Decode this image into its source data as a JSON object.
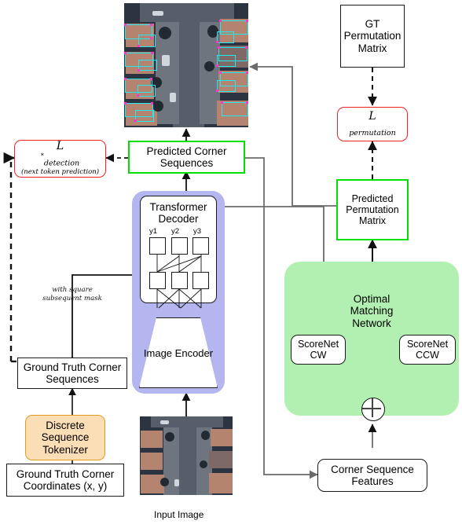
{
  "diagram": {
    "title": "Corner sequence prediction and permutation matching architecture"
  },
  "nodes": {
    "gt_permutation_matrix": "GT\nPermutation\nMatrix",
    "gt_permutation_matrix_lines": [
      "GT",
      "Permutation",
      "Matrix"
    ],
    "loss_permutation": "permutation",
    "loss_permutation_symbol": "L",
    "predicted_permutation_matrix_lines": [
      "Predicted",
      "Permutation",
      "Matrix"
    ],
    "predicted_corner_sequences_lines": [
      "Predicted Corner",
      "Sequences"
    ],
    "loss_detection_symbol": "L",
    "loss_detection_sub": "detection",
    "loss_detection_sup": "*",
    "loss_detection_note": "(next token prediction)",
    "transformer_decoder_lines": [
      "Transformer",
      "Decoder"
    ],
    "image_encoder_lines": [
      "Image",
      "Encoder"
    ],
    "optimal_matching_network_lines": [
      "Optimal",
      "Matching",
      "Network"
    ],
    "scorenet_cw_lines": [
      "ScoreNet",
      "CW"
    ],
    "scorenet_ccw_lines": [
      "ScoreNet",
      "CCW"
    ],
    "corner_sequence_features_lines": [
      "Corner Sequence",
      "Features"
    ],
    "ground_truth_corner_sequences_lines": [
      "Ground Truth Corner",
      "Sequences"
    ],
    "discrete_sequence_tokenizer_lines": [
      "Discrete",
      "Sequence",
      "Tokenizer"
    ],
    "ground_truth_corner_coordinates_lines": [
      "Ground Truth Corner",
      "Coordinates (x, y)"
    ]
  },
  "tokens": {
    "labels": [
      "y1",
      "y2",
      "y3"
    ]
  },
  "annotations": {
    "mask_note_lines": [
      "with square",
      "subsequent",
      "mask"
    ],
    "input_image_caption": "Input Image"
  },
  "colors": {
    "green_border": "#00e000",
    "red_border": "#ee2222",
    "orange_border": "#e09c1e",
    "orange_fill": "#fbddb6",
    "purple_fill": "#b5b5ef",
    "green_fill": "#b2f0b2",
    "polygon_cyan": "#24e8f0",
    "vertex_magenta": "#ff33cc",
    "wire_black": "#111111",
    "wire_gray": "#6b6b6b"
  }
}
